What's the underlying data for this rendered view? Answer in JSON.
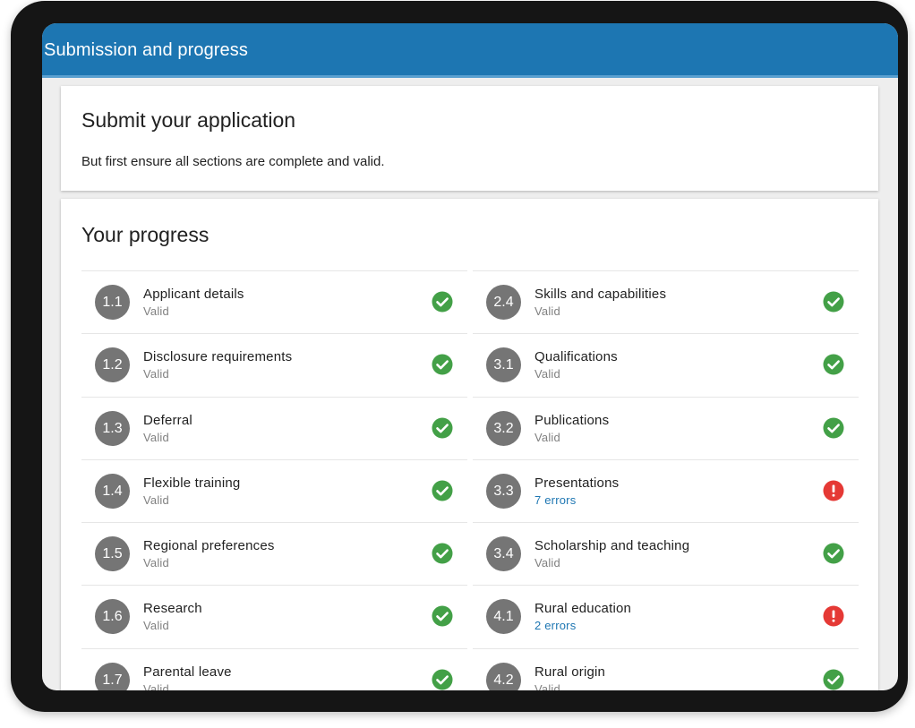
{
  "appbar": {
    "title": "Submission and progress"
  },
  "submit_card": {
    "title": "Submit your application",
    "description": "But first ensure all sections are complete and valid."
  },
  "progress_card": {
    "title": "Your progress",
    "left_items": [
      {
        "number": "1.1",
        "label": "Applicant details",
        "status": "Valid",
        "state": "valid"
      },
      {
        "number": "1.2",
        "label": "Disclosure requirements",
        "status": "Valid",
        "state": "valid"
      },
      {
        "number": "1.3",
        "label": "Deferral",
        "status": "Valid",
        "state": "valid"
      },
      {
        "number": "1.4",
        "label": "Flexible training",
        "status": "Valid",
        "state": "valid"
      },
      {
        "number": "1.5",
        "label": "Regional preferences",
        "status": "Valid",
        "state": "valid"
      },
      {
        "number": "1.6",
        "label": "Research",
        "status": "Valid",
        "state": "valid"
      },
      {
        "number": "1.7",
        "label": "Parental leave",
        "status": "Valid",
        "state": "valid"
      }
    ],
    "right_items": [
      {
        "number": "2.4",
        "label": "Skills and capabilities",
        "status": "Valid",
        "state": "valid"
      },
      {
        "number": "3.1",
        "label": "Qualifications",
        "status": "Valid",
        "state": "valid"
      },
      {
        "number": "3.2",
        "label": "Publications",
        "status": "Valid",
        "state": "valid"
      },
      {
        "number": "3.3",
        "label": "Presentations",
        "status": "7 errors",
        "state": "error"
      },
      {
        "number": "3.4",
        "label": "Scholarship and teaching",
        "status": "Valid",
        "state": "valid"
      },
      {
        "number": "4.1",
        "label": "Rural education",
        "status": "2 errors",
        "state": "error"
      },
      {
        "number": "4.2",
        "label": "Rural origin",
        "status": "Valid",
        "state": "valid"
      }
    ]
  },
  "icons": {
    "valid": "check-circle-icon",
    "error": "error-circle-icon"
  },
  "colors": {
    "appbar": "#1d76b2",
    "valid": "#43a047",
    "error": "#e53935",
    "number_badge": "#757575",
    "error_text": "#1d76b2"
  }
}
